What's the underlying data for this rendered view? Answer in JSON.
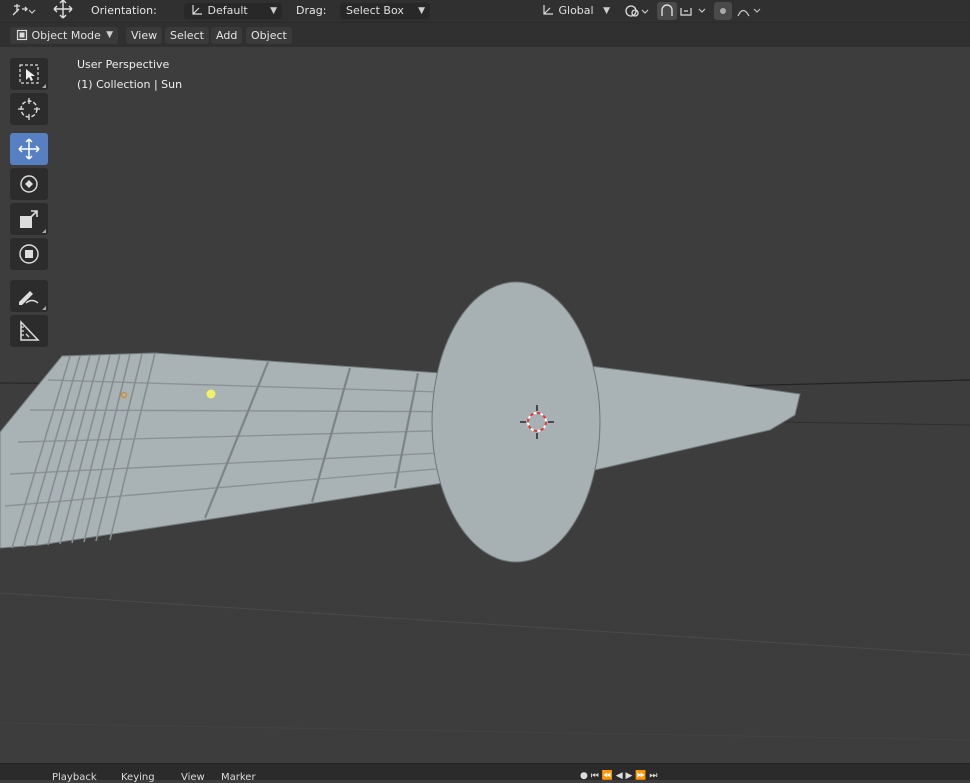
{
  "header": {
    "orientation_label": "Orientation:",
    "orientation_value": "Default",
    "drag_label": "Drag:",
    "drag_value": "Select Box",
    "transform_space": "Global"
  },
  "viewport_header": {
    "mode": "Object Mode",
    "menus": [
      "View",
      "Select",
      "Add",
      "Object"
    ]
  },
  "viewport": {
    "perspective_label": "User Perspective",
    "collection_label": "(1) Collection | Sun",
    "background_color": "#3d3d3d",
    "object_color": "#a9b3b6"
  },
  "toolbar": {
    "tools": [
      {
        "name": "select-box",
        "icon": "select-box-icon"
      },
      {
        "name": "cursor",
        "icon": "cursor-icon"
      },
      {
        "name": "move",
        "icon": "move-icon",
        "active": true
      },
      {
        "name": "rotate",
        "icon": "rotate-icon"
      },
      {
        "name": "scale",
        "icon": "scale-icon"
      },
      {
        "name": "transform",
        "icon": "transform-icon"
      },
      {
        "name": "annotate",
        "icon": "annotate-icon"
      },
      {
        "name": "measure",
        "icon": "measure-icon"
      }
    ],
    "active_color": "#5680c2"
  },
  "timeline": {
    "items": [
      "Playback",
      "Keying",
      "View",
      "Marker"
    ]
  }
}
